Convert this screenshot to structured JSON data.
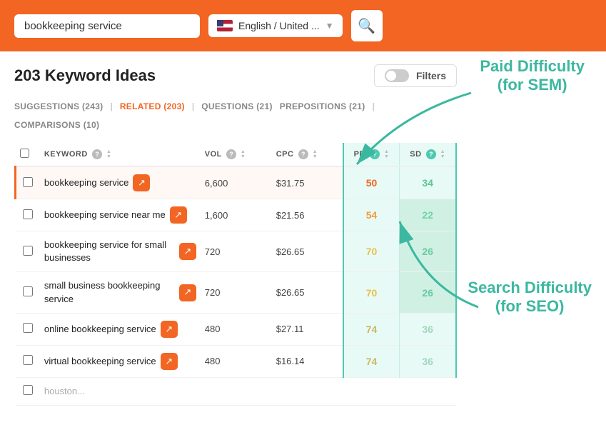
{
  "header": {
    "search_placeholder": "bookkeeping service",
    "search_value": "bookkeeping service",
    "locale_label": "English / United ...",
    "search_btn_icon": "🔍"
  },
  "results": {
    "title": "203 Keyword Ideas",
    "filters_label": "Filters"
  },
  "tabs": [
    {
      "id": "suggestions",
      "label": "SUGGESTIONS (243)",
      "active": false
    },
    {
      "id": "related",
      "label": "RELATED (203)",
      "active": true
    },
    {
      "id": "questions",
      "label": "QUESTIONS (21)",
      "active": false
    },
    {
      "id": "prepositions",
      "label": "PREPOSITIONS (21)",
      "active": false
    },
    {
      "id": "comparisons",
      "label": "COMPARISONS (10)",
      "active": false
    }
  ],
  "table": {
    "columns": {
      "keyword": "KEYWORD",
      "vol": "VOL",
      "cpc": "CPC",
      "pd": "PD",
      "sd": "SD"
    },
    "rows": [
      {
        "keyword": "bookkeeping service",
        "vol": "6,600",
        "cpc": "$31.75",
        "pd": 50,
        "sd": 34,
        "highlighted": true
      },
      {
        "keyword": "bookkeeping service near me",
        "vol": "1,600",
        "cpc": "$21.56",
        "pd": 54,
        "sd": 22,
        "highlighted": false
      },
      {
        "keyword": "bookkeeping service for small businesses",
        "vol": "720",
        "cpc": "$26.65",
        "pd": 70,
        "sd": 26,
        "highlighted": false
      },
      {
        "keyword": "small business bookkeeping service",
        "vol": "720",
        "cpc": "$26.65",
        "pd": 70,
        "sd": 26,
        "highlighted": false
      },
      {
        "keyword": "online bookkeeping service",
        "vol": "480",
        "cpc": "$27.11",
        "pd": 74,
        "sd": 36,
        "highlighted": false
      },
      {
        "keyword": "virtual bookkeeping service",
        "vol": "480",
        "cpc": "$16.14",
        "pd": 74,
        "sd": 36,
        "highlighted": false
      },
      {
        "keyword": "houston...",
        "vol": "",
        "cpc": "",
        "pd": null,
        "sd": null,
        "highlighted": false,
        "partial": true
      }
    ]
  },
  "annotations": {
    "paid_difficulty": "Paid Difficulty\n(for SEM)",
    "search_difficulty": "Search Difficulty\n(for SEO)"
  }
}
